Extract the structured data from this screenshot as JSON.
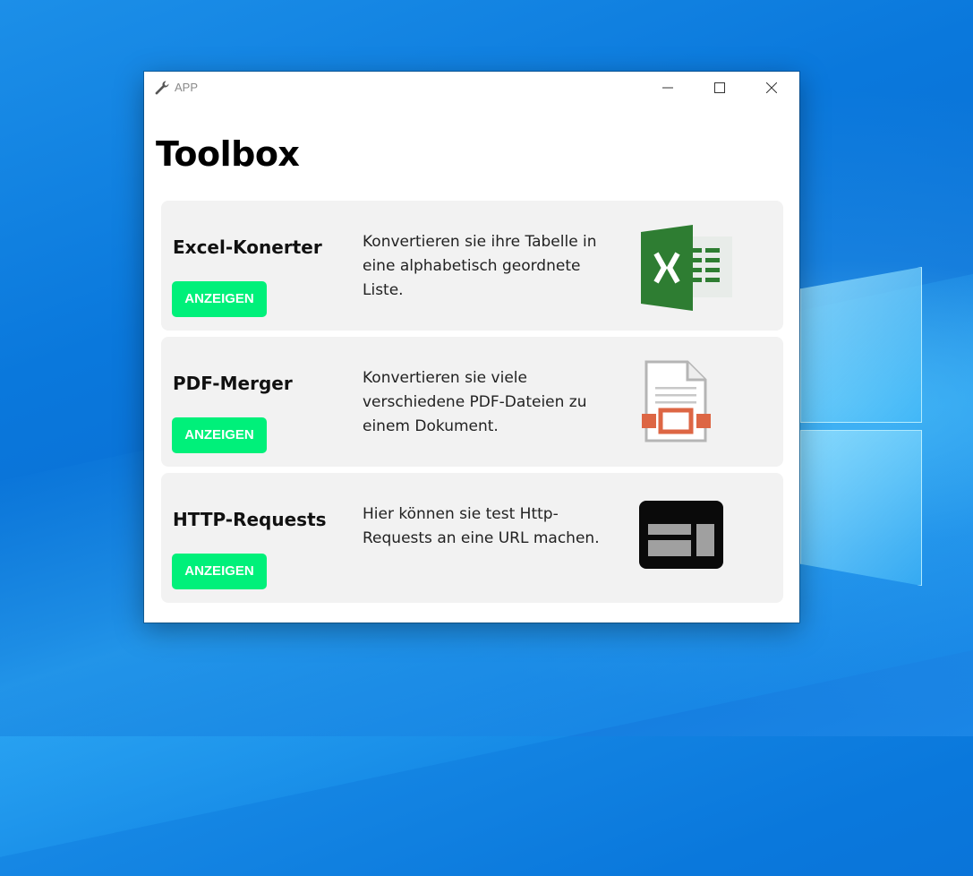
{
  "window": {
    "title": "APP"
  },
  "page": {
    "title": "Toolbox"
  },
  "cards": [
    {
      "name": "Excel-Konerter",
      "button_label": "ANZEIGEN",
      "description": "Konvertieren sie ihre Tabelle in eine alphabetisch geordnete Liste.",
      "icon": "excel-icon"
    },
    {
      "name": "PDF-Merger",
      "button_label": "ANZEIGEN",
      "description": "Konvertieren sie viele verschiedene PDF-Dateien zu einem Dokument.",
      "icon": "pdf-document-icon"
    },
    {
      "name": "HTTP-Requests",
      "button_label": "ANZEIGEN",
      "description": "Hier können sie test Http-Requests an eine URL machen.",
      "icon": "web-page-icon"
    }
  ],
  "colors": {
    "button": "#00f07a",
    "card": "#f2f2f2",
    "excel_green": "#2e7d32"
  }
}
